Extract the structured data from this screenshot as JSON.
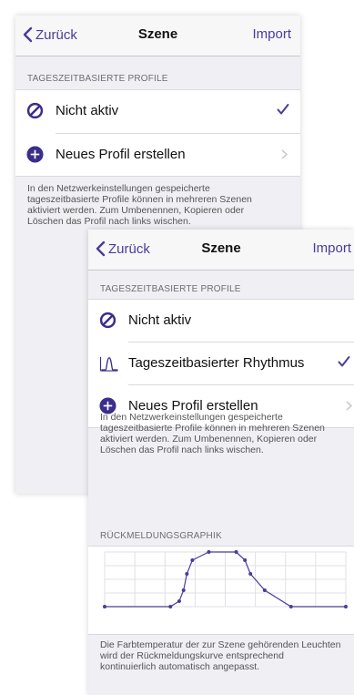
{
  "colors": {
    "accent": "#4a3c9c",
    "background": "#efeff4",
    "row": "#ffffff"
  },
  "screen1": {
    "nav": {
      "back_label": "Zurück",
      "title": "Szene",
      "right_label": "Import"
    },
    "section_header": "TAGESZEITBASIERTE PROFILE",
    "rows": [
      {
        "label": "Nicht aktiv",
        "icon": "disabled-icon",
        "selected": true
      },
      {
        "label": "Neues Profil erstellen",
        "icon": "add-circle-icon",
        "selected": false
      }
    ],
    "footer_lines": [
      "In den Netzwerkeinstellungen gespeicherte",
      "tageszeitbasierte Profile können in mehreren Szenen",
      "aktiviert werden. Zum Umbenennen, Kopieren oder",
      "Löschen  das Profil nach links wischen."
    ]
  },
  "screen2": {
    "nav": {
      "back_label": "Zurück",
      "title": "Szene",
      "right_label": "Import"
    },
    "section_header": "TAGESZEITBASIERTE PROFILE",
    "rows": [
      {
        "label": "Nicht aktiv",
        "icon": "disabled-icon",
        "selected": false
      },
      {
        "label": "Tageszeitbasierter Rhythmus",
        "icon": "rhythm-curve-icon",
        "selected": true
      },
      {
        "label": "Neues Profil erstellen",
        "icon": "add-circle-icon",
        "selected": false
      }
    ],
    "footer_lines": [
      "In den Netzwerkeinstellungen gespeicherte",
      "tageszeitbasierte Profile können in mehreren Szenen",
      "aktiviert werden. Zum Umbenennen, Kopieren oder",
      "Löschen  das Profil nach links wischen."
    ],
    "chart_header": "RÜCKMELDUNGSGRAPHIK",
    "chart_footer_lines": [
      "Die Farbtemperatur der zur Szene gehörenden Leuchten",
      "wird der Rückmeldungskurve entsprechend",
      "kontinuierlich automatisch angepasst."
    ]
  },
  "chart_data": {
    "type": "line",
    "series": [
      {
        "x": [
          0,
          6,
          6.8,
          7.2,
          7.5,
          8,
          9.5,
          12,
          12.8,
          13.3,
          14.6,
          17,
          22
        ],
        "y": [
          0,
          0,
          0.1,
          0.3,
          0.6,
          0.85,
          1,
          1,
          0.85,
          0.6,
          0.3,
          0,
          0
        ]
      }
    ],
    "xlim": [
      0,
      22
    ],
    "ylim": [
      0,
      1
    ],
    "grid": true,
    "color": "#4a3c9c"
  }
}
